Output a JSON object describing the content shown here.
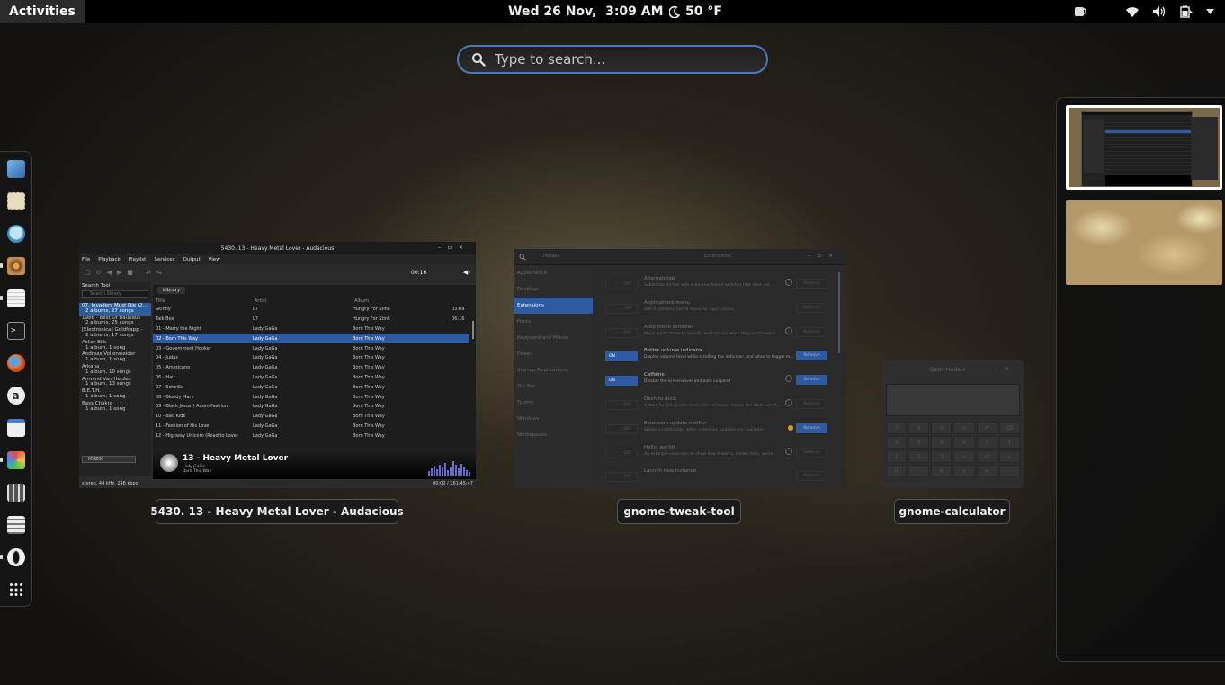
{
  "topbar": {
    "activities": "Activities",
    "clock": "Wed 26 Nov,  3:09 AM",
    "weather": "50 °F",
    "icons": [
      "coffee-icon",
      "wifi-icon",
      "volume-icon",
      "battery-icon",
      "dropdown-arrow-icon"
    ]
  },
  "search": {
    "placeholder": "Type to search..."
  },
  "dash": {
    "items": [
      {
        "name": "web-browser-icon",
        "running": false
      },
      {
        "name": "notes-icon",
        "running": false
      },
      {
        "name": "chat-icon",
        "running": false
      },
      {
        "name": "audacious-icon",
        "running": true
      },
      {
        "name": "text-editor-icon",
        "running": true
      },
      {
        "name": "terminal-icon",
        "running": false
      },
      {
        "name": "firefox-icon",
        "running": false
      },
      {
        "name": "amazon-icon",
        "running": false
      },
      {
        "name": "document-icon",
        "running": false
      },
      {
        "name": "drawing-icon",
        "running": true
      },
      {
        "name": "tweak-tool-icon",
        "running": false
      },
      {
        "name": "calculator-icon",
        "running": false
      },
      {
        "name": "opera-icon",
        "running": true
      },
      {
        "name": "app-grid-icon",
        "running": false
      }
    ]
  },
  "windows": {
    "audacious": {
      "caption": "5430. 13 - Heavy Metal Lover - Audacious",
      "title": "5430. 13 - Heavy Metal Lover - Audacious",
      "menu": [
        "File",
        "Playback",
        "Playlist",
        "Services",
        "Output",
        "View"
      ],
      "time": "00:16",
      "search_tool": "Search Tool",
      "search_placeholder": "Search library",
      "library_tab": "Library",
      "columns": [
        "Title",
        "Artist",
        "Album"
      ],
      "sidebar": [
        {
          "line1": "07. Invaders Must Die (2...",
          "line2": "2 albums, 27 songs",
          "selected": true
        },
        {
          "line1": "1986 - Best Of Bauhaus",
          "line2": "2 albums, 25 songs",
          "selected": false
        },
        {
          "line1": "[Electronica] Goldfrapp -",
          "line2": "2 albums, 17 songs",
          "selected": false
        },
        {
          "line1": "Acker Bilk",
          "line2": "1 album, 1 song",
          "selected": false
        },
        {
          "line1": "Andreas Vollenweider",
          "line2": "1 album, 1 song",
          "selected": false
        },
        {
          "line1": "Arkana",
          "line2": "1 album, 10 songs",
          "selected": false
        },
        {
          "line1": "Armand Van Helden",
          "line2": "1 album, 13 songs",
          "selected": false
        },
        {
          "line1": "B.E.T.H.",
          "line2": "1 album, 1 song",
          "selected": false
        },
        {
          "line1": "Bass Chakra",
          "line2": "1 album, 1 song",
          "selected": false
        }
      ],
      "tracks": [
        {
          "title": "Skinny",
          "artist": "L7",
          "album": "Hungry For Stink",
          "length": "03:09"
        },
        {
          "title": "Talk Box",
          "artist": "L7",
          "album": "Hungry For Stink",
          "length": "06:16"
        },
        {
          "title": "01 - Marry the Night",
          "artist": "Lady GaGa",
          "album": "Born This Way",
          "length": ""
        },
        {
          "title": "02 - Born This Way",
          "artist": "Lady GaGa",
          "album": "Born This Way",
          "length": "",
          "selected": true
        },
        {
          "title": "03 - Government Hooker",
          "artist": "Lady GaGa",
          "album": "Born This Way",
          "length": ""
        },
        {
          "title": "04 - Judas",
          "artist": "Lady GaGa",
          "album": "Born This Way",
          "length": ""
        },
        {
          "title": "05 - Americano",
          "artist": "Lady GaGa",
          "album": "Born This Way",
          "length": ""
        },
        {
          "title": "06 - Hair",
          "artist": "Lady GaGa",
          "album": "Born This Way",
          "length": ""
        },
        {
          "title": "07 - Scheiße",
          "artist": "Lady GaGa",
          "album": "Born This Way",
          "length": ""
        },
        {
          "title": "08 - Bloody Mary",
          "artist": "Lady GaGa",
          "album": "Born This Way",
          "length": ""
        },
        {
          "title": "09 - Black Jesus † Amen Fashion",
          "artist": "Lady GaGa",
          "album": "Born This Way",
          "length": ""
        },
        {
          "title": "10 - Bad Kids",
          "artist": "Lady GaGa",
          "album": "Born This Way",
          "length": ""
        },
        {
          "title": "11 - Fashion of His Love",
          "artist": "Lady GaGa",
          "album": "Born This Way",
          "length": ""
        },
        {
          "title": "12 - Highway Unicorn (Road to Love)",
          "artist": "Lady GaGa",
          "album": "Born This Way",
          "length": ""
        }
      ],
      "now_playing": {
        "title": "13 - Heavy Metal Lover",
        "artist": "Lady GaGa",
        "album": "Born This Way"
      },
      "library_select": "MUZIK",
      "status_left": "stereo, 44 kHz, 248 kbps",
      "status_right": "00:00 / 261:45:47"
    },
    "tweak": {
      "caption": "gnome-tweak-tool",
      "title_left": "Tweaks",
      "title_center": "Extensions",
      "nav": [
        "Appearance",
        "Desktop",
        "Extensions",
        "Fonts",
        "Keyboard and Mouse",
        "Power",
        "Startup Applications",
        "Top Bar",
        "Typing",
        "Windows",
        "Workspaces"
      ],
      "nav_selected": 2,
      "extensions": [
        {
          "name": "Alternatetab",
          "desc": "Substitute alt-tab with a window based switcher that does not ...",
          "on": false,
          "gear": true,
          "warn": false
        },
        {
          "name": "Applications menu",
          "desc": "Add a category-based menu for applications.",
          "on": false,
          "gear": false,
          "warn": false
        },
        {
          "name": "Auto move windows",
          "desc": "Move applications to specific workspaces when they create wind...",
          "on": false,
          "gear": true,
          "warn": false
        },
        {
          "name": "Better volume indicator",
          "desc": "Display volume level while scrolling the indicator, and allow to toggle m...",
          "on": true,
          "gear": false,
          "warn": false
        },
        {
          "name": "Caffeine",
          "desc": "Disable the screensaver and auto suspend",
          "on": true,
          "gear": true,
          "warn": false
        },
        {
          "name": "Dash to dock",
          "desc": "A dock for the gnome shell, this extension moves the dash out of ...",
          "on": false,
          "gear": true,
          "warn": false
        },
        {
          "name": "Extension update notifier",
          "desc": "Shows a notification when extension updates are available",
          "on": false,
          "gear": false,
          "warn": true
        },
        {
          "name": "Hello, world!",
          "desc": "An example extension to show how it works, shows hello, world ...",
          "on": false,
          "gear": true,
          "warn": false
        },
        {
          "name": "Launch new instance",
          "desc": "",
          "on": false,
          "gear": false,
          "warn": false
        }
      ],
      "on_label": "ON",
      "off_label": "OFF",
      "remove_label": "Remove"
    },
    "calculator": {
      "caption": "gnome-calculator",
      "mode": "Basic Mode",
      "keys": [
        "7",
        "8",
        "9",
        "÷",
        "↶",
        "⌫",
        "4",
        "5",
        "6",
        "×",
        "(",
        ")",
        "1",
        "2",
        "3",
        "−",
        "x²",
        "√",
        "0",
        ".",
        "%",
        "+",
        "=",
        ""
      ]
    }
  }
}
